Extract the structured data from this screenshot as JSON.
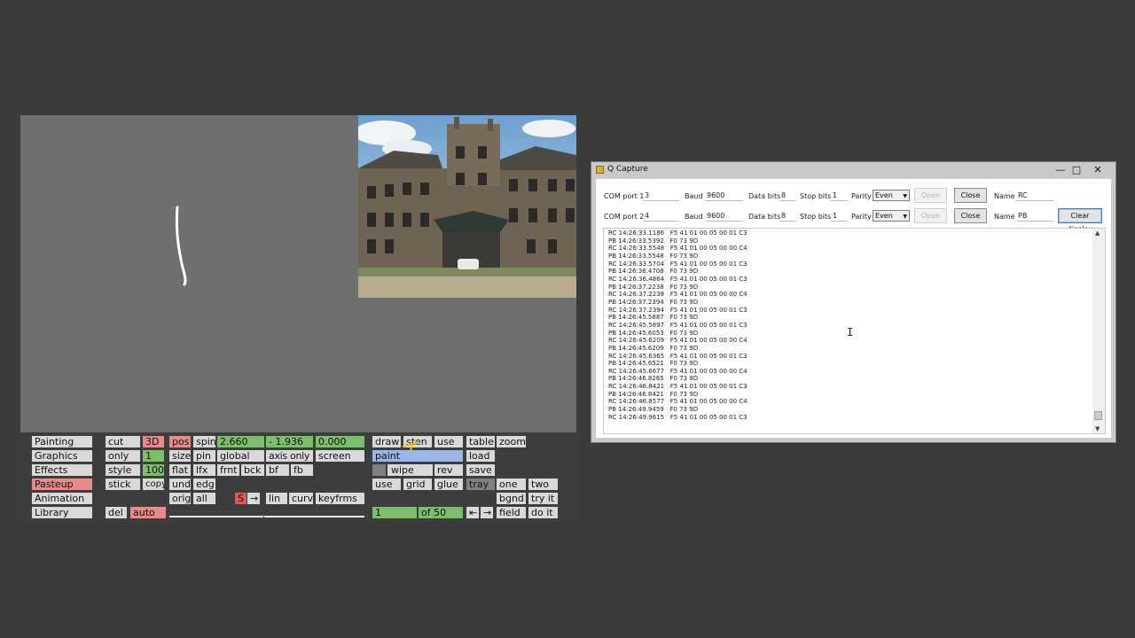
{
  "paint_menu": {
    "col1": [
      "Painting",
      "Graphics",
      "Effects",
      "Pasteup",
      "Animation",
      "Library"
    ],
    "col2": [
      "cut",
      "only",
      "style",
      "stick",
      "del"
    ],
    "col2b": [
      "3D",
      "1",
      "100",
      "copy",
      "auto"
    ],
    "row1": {
      "pos": "pos",
      "spin": "spin",
      "v1": "2.660",
      "v2": "- 1.936",
      "v3": "0.000",
      "draw": "draw",
      "sten": "sten",
      "use": "use",
      "table": "table",
      "zoom": "zoom"
    },
    "row2": {
      "size": "size",
      "pin": "pin",
      "global": "global",
      "axisonly": "axis only",
      "screen": "screen",
      "paint": "paint",
      "load": "load"
    },
    "row3": {
      "flat": "flat",
      "lfx": "lfx",
      "frnt": "frnt",
      "bck": "bck",
      "bf": "bf",
      "fb": "fb",
      "wipe": "wipe",
      "rev": "rev",
      "save": "save"
    },
    "row4": {
      "und": "und",
      "edg": "edg",
      "use": "use",
      "grid": "grid",
      "glue": "glue",
      "tray": "tray",
      "one": "one",
      "two": "two"
    },
    "row5": {
      "orig": "orig",
      "all": "all",
      "s": "S",
      "arrow": "→",
      "lin": "lin",
      "curv": "curv",
      "keyfrms": "keyfrms",
      "bgnd": "bgnd",
      "tryit": "try it"
    },
    "row6": {
      "frame": "1",
      "of": "of 50",
      "prev": "⇤",
      "next": "→",
      "field": "field",
      "doit": "do it"
    }
  },
  "qcapture": {
    "title": "Q Capture",
    "minimize": "—",
    "maximize": "□",
    "close": "✕",
    "port1": {
      "com_label": "COM port 1",
      "com": "3",
      "baud_label": "Baud",
      "baud": "9600",
      "databits_label": "Data bits",
      "databits": "8",
      "stopbits_label": "Stop bits",
      "stopbits": "1",
      "parity_label": "Parity",
      "parity": "Even",
      "open": "Open",
      "close": "Close",
      "name_label": "Name",
      "name": "RC"
    },
    "port2": {
      "com_label": "COM port 2",
      "com": "4",
      "baud_label": "Baud",
      "baud": "9600",
      "databits_label": "Data bits",
      "databits": "8",
      "stopbits_label": "Stop bits",
      "stopbits": "1",
      "parity_label": "Parity",
      "parity": "Even",
      "open": "Open",
      "close": "Close",
      "name_label": "Name",
      "name": "PB"
    },
    "clear_display": "Clear display",
    "log": [
      "RC 14:26:33.1186   F5 41 01 00 05 00 01 C3",
      "PB 14:26:33.5392   F0 73 9D",
      "RC 14:26:33.5548   F5 41 01 00 05 00 00 C4",
      "PB 14:26:33.5548   F0 73 9D",
      "RC 14:26:33.5704   F5 41 01 00 05 00 01 C3",
      "PB 14:26:36.4708   F0 73 9D",
      "RC 14:26:36.4864   F5 41 01 00 05 00 01 C3",
      "PB 14:26:37.2238   F0 73 9D",
      "RC 14:26:37.2238   F5 41 01 00 05 00 00 C4",
      "PB 14:26:37.2394   F0 73 9D",
      "RC 14:26:37.2394   F5 41 01 00 05 00 01 C3",
      "PB 14:26:45.5887   F0 73 9D",
      "RC 14:26:45.5897   F5 41 01 00 05 00 01 C3",
      "PB 14:26:45.6053   F0 73 9D",
      "RC 14:26:45.6209   F5 41 01 00 05 00 00 C4",
      "PB 14:26:45.6209   F0 73 9D",
      "RC 14:26:45.6365   F5 41 01 00 05 00 01 C3",
      "PB 14:26:45.6521   F0 73 9D",
      "RC 14:26:45.6677   F5 41 01 00 05 00 00 C4",
      "PB 14:26:46.8265   F0 73 9D",
      "RC 14:26:46.8421   F5 41 01 00 05 00 01 C3",
      "PB 14:26:46.8421   F0 73 9D",
      "RC 14:26:46.8577   F5 41 01 00 05 00 00 C4",
      "PB 14:26:49.9459   F0 73 9D",
      "RC 14:26:49.9615   F5 41 01 00 05 00 01 C3"
    ]
  }
}
